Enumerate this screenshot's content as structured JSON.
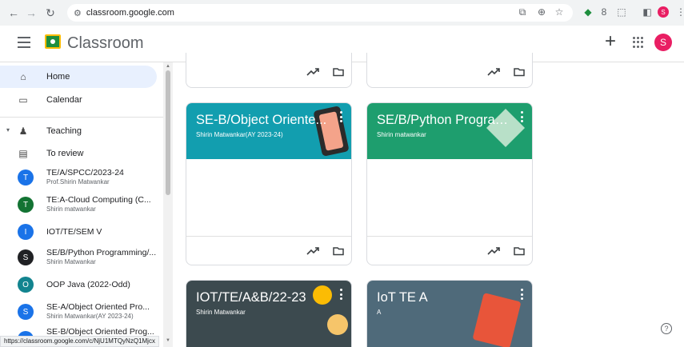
{
  "browser": {
    "url": "classroom.google.com",
    "status_url": "https://classroom.google.com/c/NjU1MTQyNzQ1Mjcx"
  },
  "appbar": {
    "title": "Classroom",
    "account_initial": "S"
  },
  "sidebar": {
    "home": "Home",
    "calendar": "Calendar",
    "teaching": "Teaching",
    "to_review": "To review",
    "classes": [
      {
        "initial": "T",
        "name": "TE/A/SPCC/2023-24",
        "sub": "Prof.Shirin Matwankar",
        "color": "#1a73e8"
      },
      {
        "initial": "T",
        "name": "TE:A-Cloud Computing (C...",
        "sub": "Shirin matwankar",
        "color": "#137333"
      },
      {
        "initial": "I",
        "name": "IOT/TE/SEM V",
        "sub": "",
        "color": "#1a73e8"
      },
      {
        "initial": "S",
        "name": "SE/B/Python Programming/...",
        "sub": "Shirin Matwankar",
        "color": "#202124"
      },
      {
        "initial": "O",
        "name": "OOP Java (2022-Odd)",
        "sub": "",
        "color": "#12848f"
      },
      {
        "initial": "S",
        "name": "SE-A/Object Oriented Pro...",
        "sub": "Shirin Matwankar(AY 2023-24)",
        "color": "#1a73e8"
      },
      {
        "initial": "S",
        "name": "SE-B/Object Oriented Prog...",
        "sub": "",
        "color": "#1a73e8"
      }
    ]
  },
  "cards": [
    {
      "title": "SE-B/Object Oriente...",
      "sub": "Shirin Matwankar(AY 2023-24)",
      "color": "#129eaf"
    },
    {
      "title": "SE/B/Python Program...",
      "sub": "Shirin matwankar",
      "color": "#1e9e6e"
    },
    {
      "title": "IOT/TE/A&B/22-23",
      "sub": "Shirin Matwankar",
      "color": "#3c4a4f"
    },
    {
      "title": "IoT TE A",
      "sub": "A",
      "color": "#4f6a7a"
    }
  ],
  "help_label": "?"
}
